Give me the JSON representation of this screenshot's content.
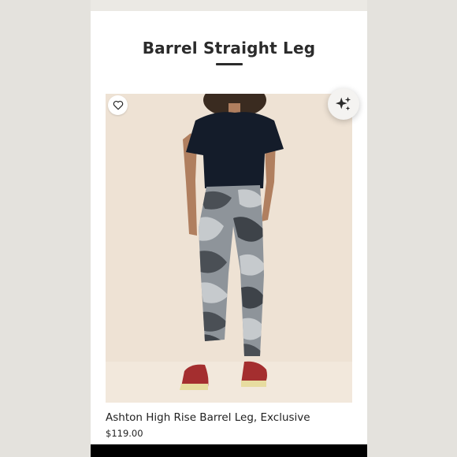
{
  "page": {
    "section_title": "Barrel Straight Leg"
  },
  "product": {
    "name": "Ashton High Rise Barrel Leg, Exclusive",
    "price": "$119.00",
    "image_icon": "product-photo"
  },
  "icons": {
    "favorite": "heart-outline-icon",
    "ai_assistant": "sparkle-icon"
  },
  "colors": {
    "background": "#ffffff",
    "image_backdrop": "#eee2d4",
    "text": "#222222",
    "bottom_bar": "#000000"
  }
}
